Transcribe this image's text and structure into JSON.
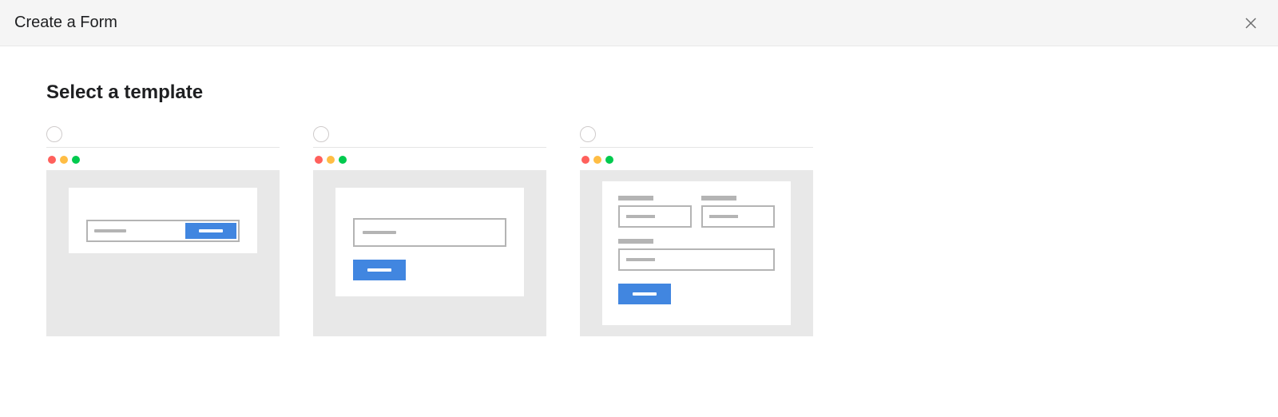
{
  "header": {
    "title": "Create a Form"
  },
  "section": {
    "title": "Select a template"
  }
}
